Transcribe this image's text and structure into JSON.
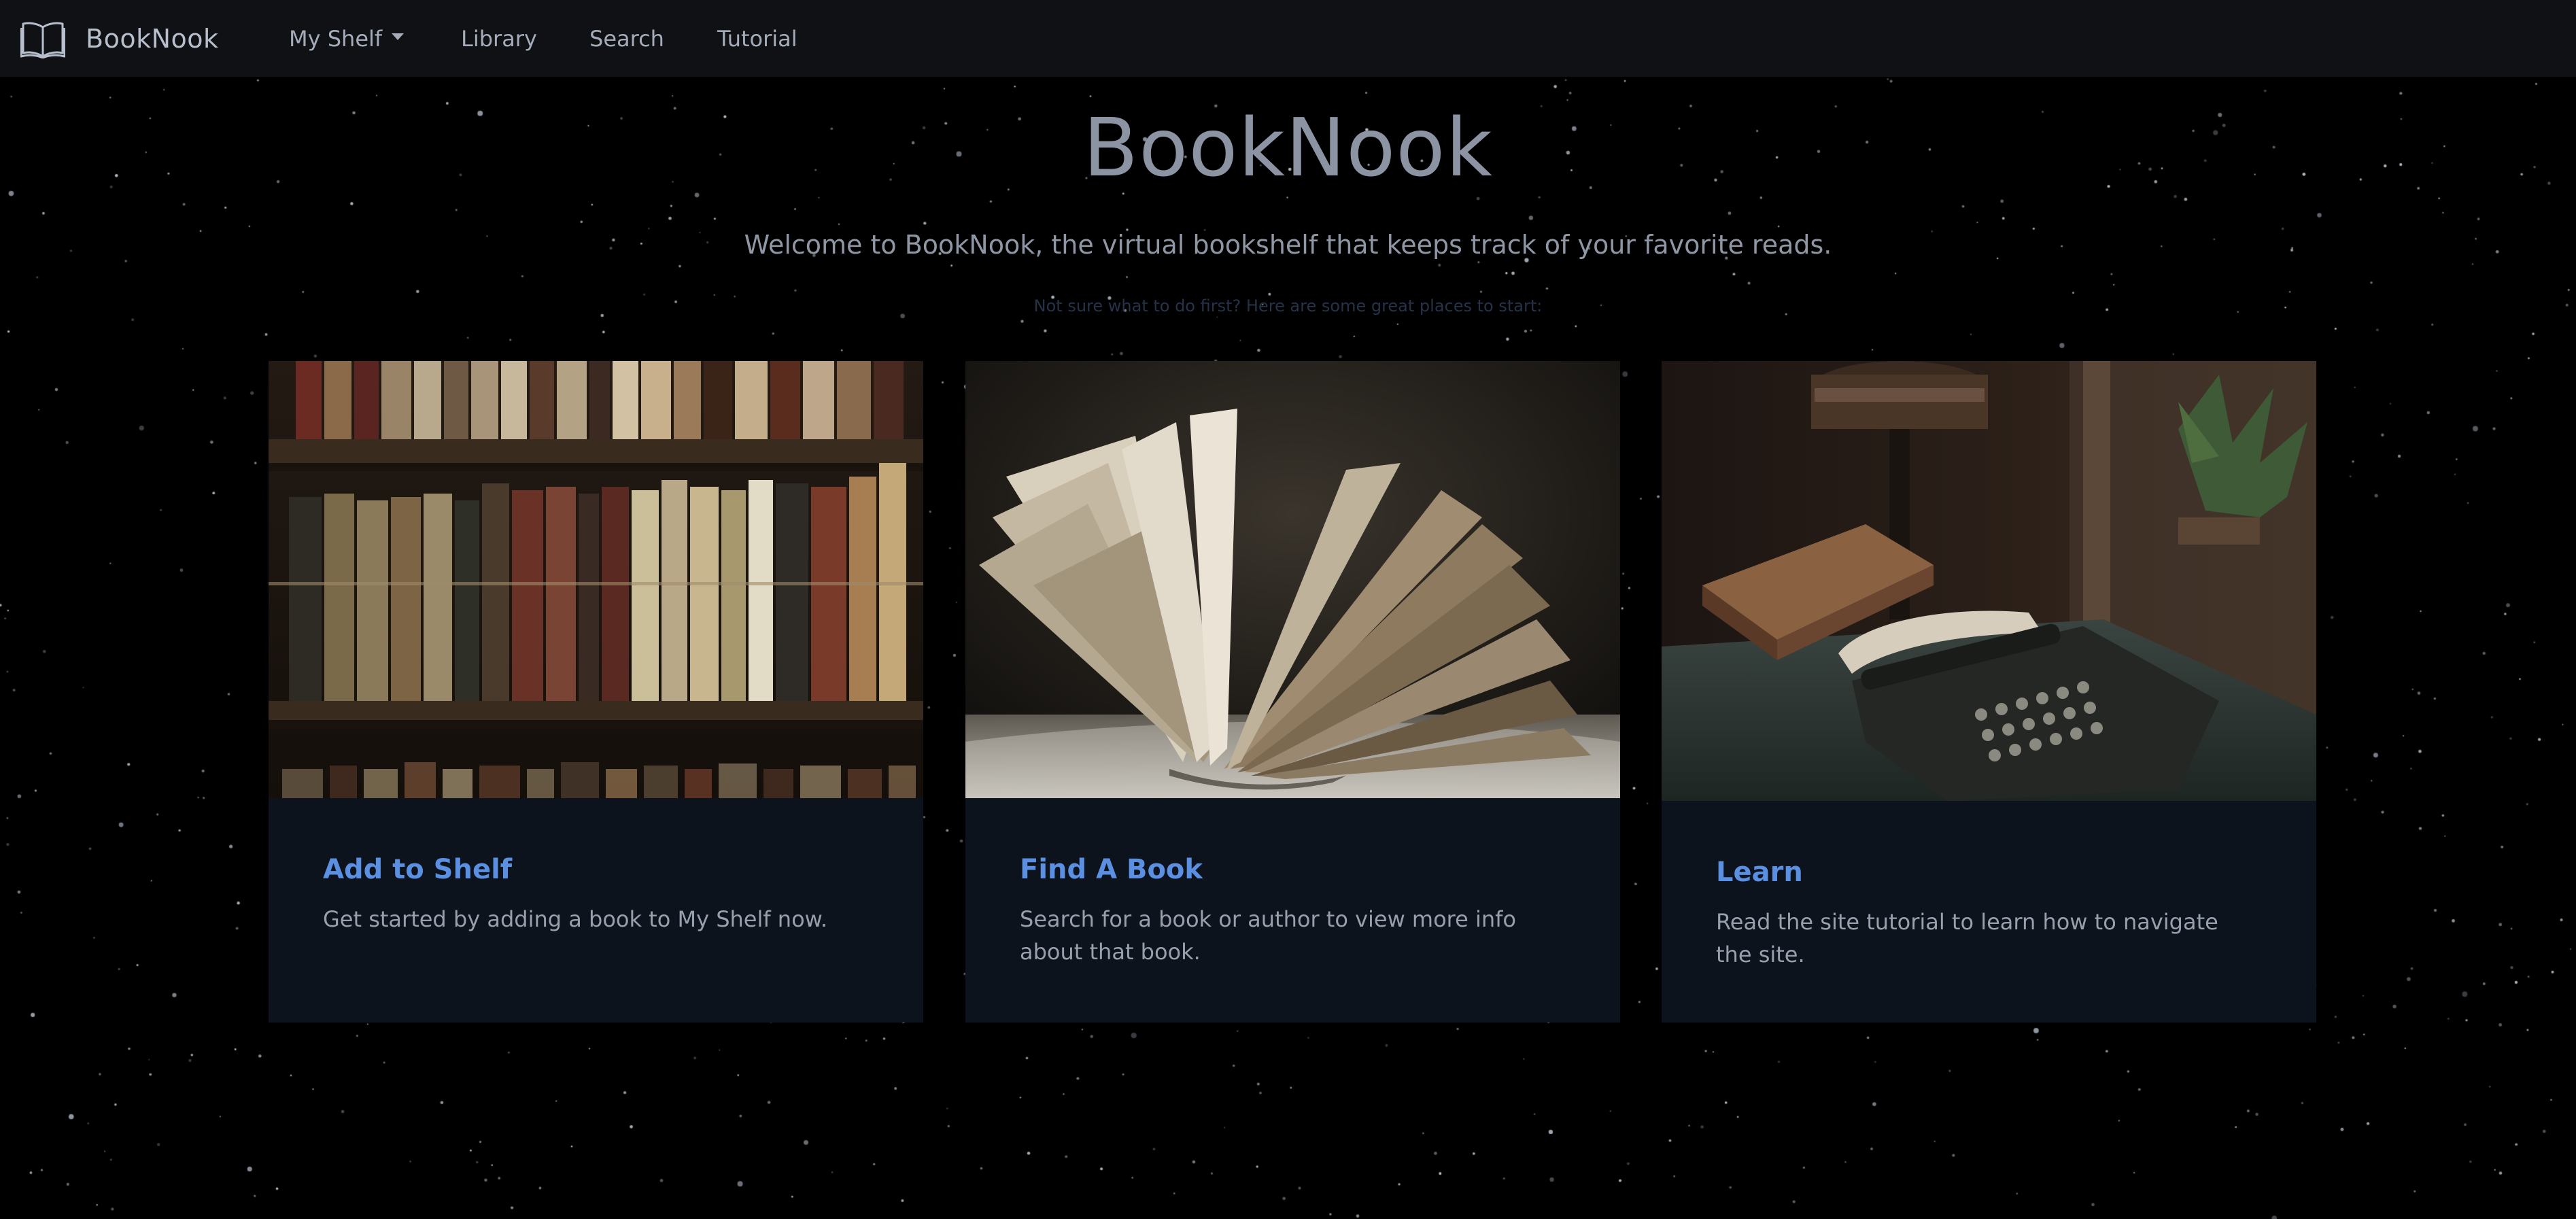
{
  "navbar": {
    "brand": "BookNook",
    "items": [
      {
        "label": "My Shelf",
        "has_dropdown": true
      },
      {
        "label": "Library"
      },
      {
        "label": "Search"
      },
      {
        "label": "Tutorial"
      }
    ]
  },
  "hero": {
    "title": "BookNook",
    "lead": "Welcome to BookNook, the virtual bookshelf that keeps track of your favorite reads.",
    "hint": "Not sure what to do first? Here are some great places to start:"
  },
  "cards": [
    {
      "image": "antique-books-on-shelf",
      "title": "Add to Shelf",
      "text": "Get started by adding a book to My Shelf now."
    },
    {
      "image": "open-book-pages",
      "title": "Find A Book",
      "text": "Search for a book or author to view more info about that book."
    },
    {
      "image": "vintage-typewriter-and-lamp",
      "title": "Learn",
      "text": "Read the site tutorial to learn how to navigate the site."
    }
  ],
  "colors": {
    "background": "#000000",
    "navbar": "#0f1115",
    "card": "#0c131c",
    "link": "#5b8fe1",
    "muted_text": "#98a0ad"
  },
  "icons": {
    "brand": "open-book-icon",
    "dropdown": "caret-down-icon"
  }
}
